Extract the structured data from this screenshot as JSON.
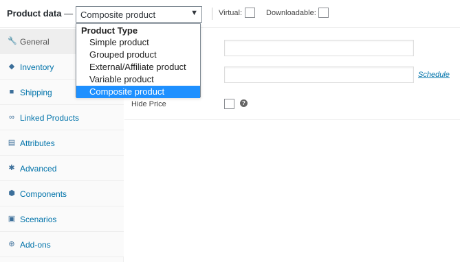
{
  "header": {
    "title": "Product data",
    "title_dash": "—",
    "product_type_value": "Composite product",
    "virtual_label": "Virtual:",
    "downloadable_label": "Downloadable:"
  },
  "dropdown": {
    "group_label": "Product Type",
    "options": [
      {
        "label": "Simple product",
        "selected": false
      },
      {
        "label": "Grouped product",
        "selected": false
      },
      {
        "label": "External/Affiliate product",
        "selected": false
      },
      {
        "label": "Variable product",
        "selected": false
      },
      {
        "label": "Composite product",
        "selected": true
      }
    ]
  },
  "sidebar": {
    "items": [
      {
        "label": "General",
        "icon": "wrench-icon",
        "active": true
      },
      {
        "label": "Inventory",
        "icon": "tag-icon",
        "active": false
      },
      {
        "label": "Shipping",
        "icon": "truck-icon",
        "active": false
      },
      {
        "label": "Linked Products",
        "icon": "link-icon",
        "active": false
      },
      {
        "label": "Attributes",
        "icon": "list-icon",
        "active": false
      },
      {
        "label": "Advanced",
        "icon": "gear-icon",
        "active": false
      },
      {
        "label": "Components",
        "icon": "components-icon",
        "active": false
      },
      {
        "label": "Scenarios",
        "icon": "scenarios-icon",
        "active": false
      },
      {
        "label": "Add-ons",
        "icon": "plus-circle-icon",
        "active": false
      }
    ]
  },
  "general": {
    "schedule_link": "Schedule",
    "hide_price_label": "Hide Price"
  },
  "colors": {
    "link": "#0073aa",
    "selected_option": "#1e90ff",
    "sidebar_bg": "#fafafa",
    "active_tab_bg": "#eeeeee"
  }
}
